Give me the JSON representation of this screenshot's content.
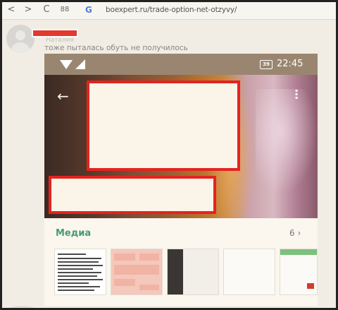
{
  "browser": {
    "back": "<",
    "forward": ">",
    "reload": "C",
    "tabs": "88",
    "search_logo": "G",
    "url": "boexpert.ru/trade-option-net-otzyvy/"
  },
  "comment": {
    "author": "Наталия",
    "text": "тоже пыталась обуть не получилось"
  },
  "phone": {
    "battery": "39",
    "time": "22:45",
    "back_icon": "arrow-left-icon",
    "more_icon": "more-vertical-icon",
    "media_title": "Медиа",
    "media_count": "6",
    "media_chevron": "›"
  },
  "colors": {
    "redaction": "#e5231f",
    "status_bar": "#9a8670",
    "media_title": "#4a9a6e"
  }
}
